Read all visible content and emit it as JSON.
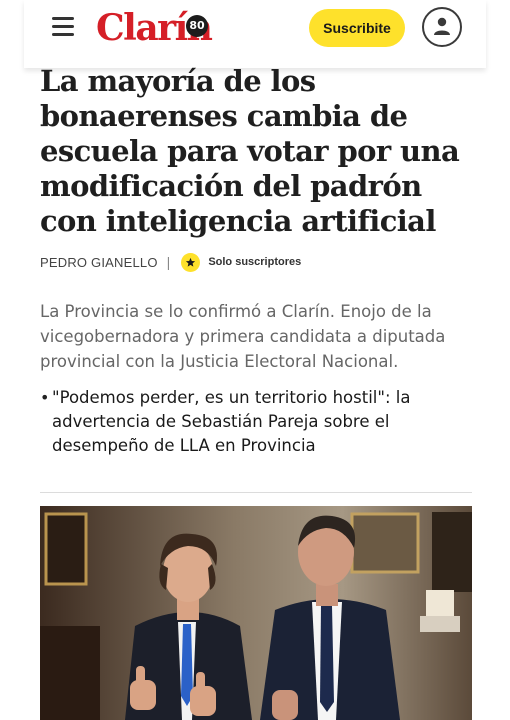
{
  "header": {
    "menu_icon": "hamburger-menu-icon",
    "logo_text": "Clarín",
    "logo_badge": "80",
    "subscribe_label": "Suscribite",
    "user_icon": "user-icon",
    "brand_red": "#d51f27",
    "accent_yellow": "#fee12b"
  },
  "article": {
    "headline": "La mayoría de los bonaerenses cambia de escuela para votar por una modificación del padrón con inteligencia artificial",
    "author": "PEDRO GIANELLO",
    "separator": "|",
    "badge_icon": "star-icon",
    "badge_label": "Solo suscriptores",
    "summary": "La Provincia se lo confirmó a Clarín. Enojo de la vicegobernadora y primera candidata a diputada provincial con la Justicia Electoral Nacional.",
    "related_bullet": "•",
    "related_link": "\"Podemos perder, es un territorio hostil\": la advertencia de Sebastián Pareja sobre el desempeño de LLA en Provincia",
    "photo_icon": "article-photo"
  }
}
